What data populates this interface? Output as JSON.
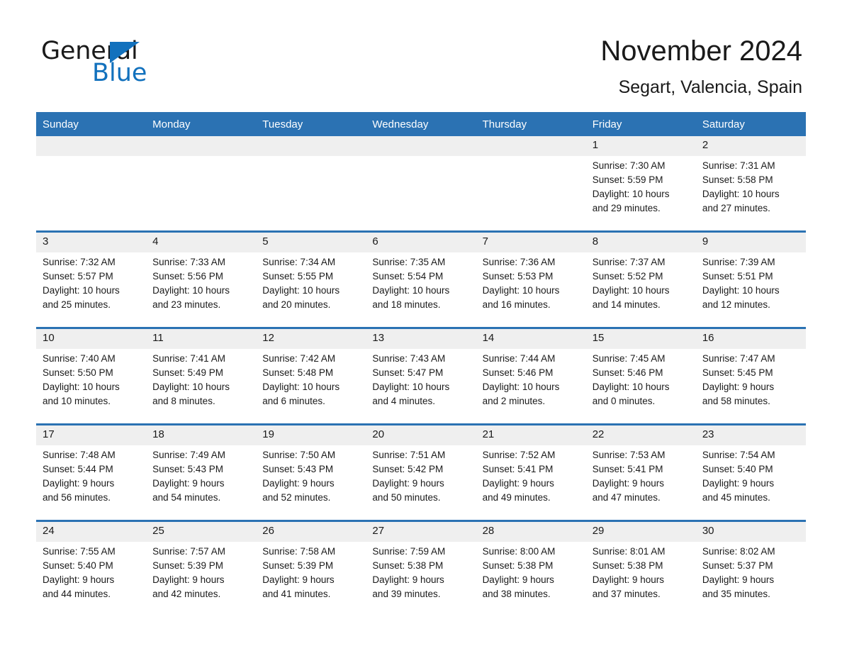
{
  "brand": {
    "name_part1": "General",
    "name_part2": "Blue",
    "triangle_color": "#1271bd",
    "accent_color": "#2b72b3"
  },
  "header": {
    "title": "November 2024",
    "subtitle": "Segart, Valencia, Spain"
  },
  "calendar": {
    "weekday_headers": [
      "Sunday",
      "Monday",
      "Tuesday",
      "Wednesday",
      "Thursday",
      "Friday",
      "Saturday"
    ],
    "weeks": [
      [
        {
          "day": "",
          "lines": []
        },
        {
          "day": "",
          "lines": []
        },
        {
          "day": "",
          "lines": []
        },
        {
          "day": "",
          "lines": []
        },
        {
          "day": "",
          "lines": []
        },
        {
          "day": "1",
          "lines": [
            "Sunrise: 7:30 AM",
            "Sunset: 5:59 PM",
            "Daylight: 10 hours",
            "and 29 minutes."
          ]
        },
        {
          "day": "2",
          "lines": [
            "Sunrise: 7:31 AM",
            "Sunset: 5:58 PM",
            "Daylight: 10 hours",
            "and 27 minutes."
          ]
        }
      ],
      [
        {
          "day": "3",
          "lines": [
            "Sunrise: 7:32 AM",
            "Sunset: 5:57 PM",
            "Daylight: 10 hours",
            "and 25 minutes."
          ]
        },
        {
          "day": "4",
          "lines": [
            "Sunrise: 7:33 AM",
            "Sunset: 5:56 PM",
            "Daylight: 10 hours",
            "and 23 minutes."
          ]
        },
        {
          "day": "5",
          "lines": [
            "Sunrise: 7:34 AM",
            "Sunset: 5:55 PM",
            "Daylight: 10 hours",
            "and 20 minutes."
          ]
        },
        {
          "day": "6",
          "lines": [
            "Sunrise: 7:35 AM",
            "Sunset: 5:54 PM",
            "Daylight: 10 hours",
            "and 18 minutes."
          ]
        },
        {
          "day": "7",
          "lines": [
            "Sunrise: 7:36 AM",
            "Sunset: 5:53 PM",
            "Daylight: 10 hours",
            "and 16 minutes."
          ]
        },
        {
          "day": "8",
          "lines": [
            "Sunrise: 7:37 AM",
            "Sunset: 5:52 PM",
            "Daylight: 10 hours",
            "and 14 minutes."
          ]
        },
        {
          "day": "9",
          "lines": [
            "Sunrise: 7:39 AM",
            "Sunset: 5:51 PM",
            "Daylight: 10 hours",
            "and 12 minutes."
          ]
        }
      ],
      [
        {
          "day": "10",
          "lines": [
            "Sunrise: 7:40 AM",
            "Sunset: 5:50 PM",
            "Daylight: 10 hours",
            "and 10 minutes."
          ]
        },
        {
          "day": "11",
          "lines": [
            "Sunrise: 7:41 AM",
            "Sunset: 5:49 PM",
            "Daylight: 10 hours",
            "and 8 minutes."
          ]
        },
        {
          "day": "12",
          "lines": [
            "Sunrise: 7:42 AM",
            "Sunset: 5:48 PM",
            "Daylight: 10 hours",
            "and 6 minutes."
          ]
        },
        {
          "day": "13",
          "lines": [
            "Sunrise: 7:43 AM",
            "Sunset: 5:47 PM",
            "Daylight: 10 hours",
            "and 4 minutes."
          ]
        },
        {
          "day": "14",
          "lines": [
            "Sunrise: 7:44 AM",
            "Sunset: 5:46 PM",
            "Daylight: 10 hours",
            "and 2 minutes."
          ]
        },
        {
          "day": "15",
          "lines": [
            "Sunrise: 7:45 AM",
            "Sunset: 5:46 PM",
            "Daylight: 10 hours",
            "and 0 minutes."
          ]
        },
        {
          "day": "16",
          "lines": [
            "Sunrise: 7:47 AM",
            "Sunset: 5:45 PM",
            "Daylight: 9 hours",
            "and 58 minutes."
          ]
        }
      ],
      [
        {
          "day": "17",
          "lines": [
            "Sunrise: 7:48 AM",
            "Sunset: 5:44 PM",
            "Daylight: 9 hours",
            "and 56 minutes."
          ]
        },
        {
          "day": "18",
          "lines": [
            "Sunrise: 7:49 AM",
            "Sunset: 5:43 PM",
            "Daylight: 9 hours",
            "and 54 minutes."
          ]
        },
        {
          "day": "19",
          "lines": [
            "Sunrise: 7:50 AM",
            "Sunset: 5:43 PM",
            "Daylight: 9 hours",
            "and 52 minutes."
          ]
        },
        {
          "day": "20",
          "lines": [
            "Sunrise: 7:51 AM",
            "Sunset: 5:42 PM",
            "Daylight: 9 hours",
            "and 50 minutes."
          ]
        },
        {
          "day": "21",
          "lines": [
            "Sunrise: 7:52 AM",
            "Sunset: 5:41 PM",
            "Daylight: 9 hours",
            "and 49 minutes."
          ]
        },
        {
          "day": "22",
          "lines": [
            "Sunrise: 7:53 AM",
            "Sunset: 5:41 PM",
            "Daylight: 9 hours",
            "and 47 minutes."
          ]
        },
        {
          "day": "23",
          "lines": [
            "Sunrise: 7:54 AM",
            "Sunset: 5:40 PM",
            "Daylight: 9 hours",
            "and 45 minutes."
          ]
        }
      ],
      [
        {
          "day": "24",
          "lines": [
            "Sunrise: 7:55 AM",
            "Sunset: 5:40 PM",
            "Daylight: 9 hours",
            "and 44 minutes."
          ]
        },
        {
          "day": "25",
          "lines": [
            "Sunrise: 7:57 AM",
            "Sunset: 5:39 PM",
            "Daylight: 9 hours",
            "and 42 minutes."
          ]
        },
        {
          "day": "26",
          "lines": [
            "Sunrise: 7:58 AM",
            "Sunset: 5:39 PM",
            "Daylight: 9 hours",
            "and 41 minutes."
          ]
        },
        {
          "day": "27",
          "lines": [
            "Sunrise: 7:59 AM",
            "Sunset: 5:38 PM",
            "Daylight: 9 hours",
            "and 39 minutes."
          ]
        },
        {
          "day": "28",
          "lines": [
            "Sunrise: 8:00 AM",
            "Sunset: 5:38 PM",
            "Daylight: 9 hours",
            "and 38 minutes."
          ]
        },
        {
          "day": "29",
          "lines": [
            "Sunrise: 8:01 AM",
            "Sunset: 5:38 PM",
            "Daylight: 9 hours",
            "and 37 minutes."
          ]
        },
        {
          "day": "30",
          "lines": [
            "Sunrise: 8:02 AM",
            "Sunset: 5:37 PM",
            "Daylight: 9 hours",
            "and 35 minutes."
          ]
        }
      ]
    ]
  }
}
